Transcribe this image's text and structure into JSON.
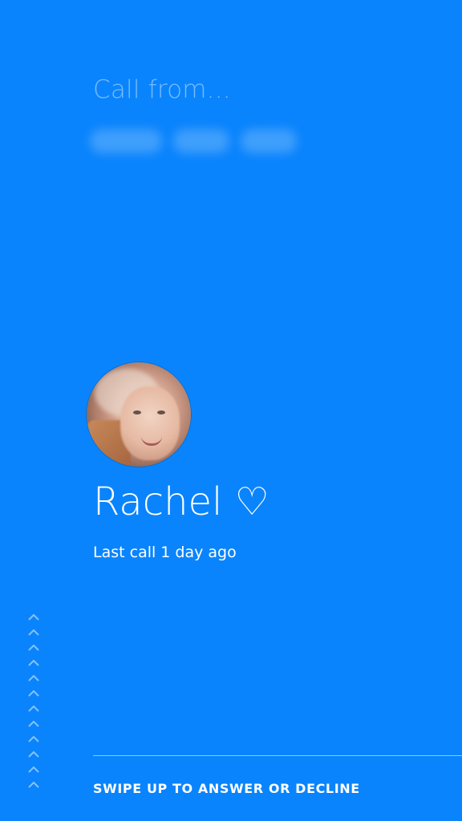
{
  "header": {
    "call_from_label": "Call from..."
  },
  "contact": {
    "name": "Rachel ♡",
    "last_call": "Last call 1 day ago",
    "avatar_icon": "contact-photo"
  },
  "footer": {
    "swipe_hint": "SWIPE UP TO ANSWER OR DECLINE",
    "chevron_icon": "chevron-up-icon",
    "chevron_count": 12
  },
  "colors": {
    "background": "#0a84fc",
    "text": "#ffffff"
  }
}
